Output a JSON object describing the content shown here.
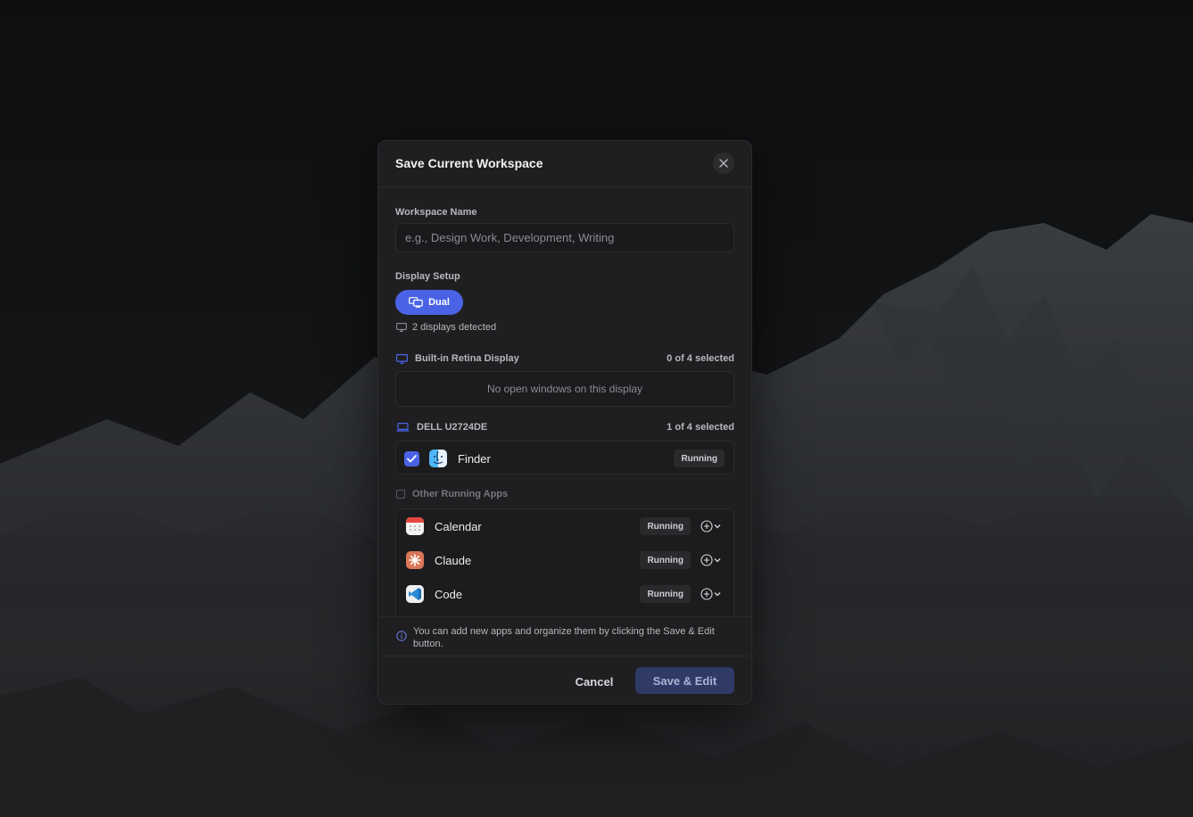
{
  "dialog": {
    "title": "Save Current Workspace",
    "close_icon": "close-icon"
  },
  "workspace_name": {
    "label": "Workspace Name",
    "placeholder": "e.g., Design Work, Development, Writing",
    "value": ""
  },
  "display_setup": {
    "label": "Display Setup",
    "selected_option": "Dual",
    "option_icon": "dual-monitor-icon",
    "detected_text": "2 displays detected",
    "accent_color": "#4a63e6"
  },
  "displays": [
    {
      "name": "Built-in Retina Display",
      "icon": "monitor-icon",
      "selection_count": "0 of 4 selected",
      "empty_text": "No open windows on this display",
      "windows": []
    },
    {
      "name": "DELL U2724DE",
      "icon": "laptop-icon",
      "selection_count": "1 of 4 selected",
      "windows": [
        {
          "app": "Finder",
          "status": "Running",
          "checked": true,
          "icon": "finder-icon"
        }
      ]
    }
  ],
  "other_apps": {
    "label": "Other Running Apps",
    "apps": [
      {
        "name": "Calendar",
        "status": "Running",
        "icon": "calendar-icon"
      },
      {
        "name": "Claude",
        "status": "Running",
        "icon": "claude-icon"
      },
      {
        "name": "Code",
        "status": "Running",
        "icon": "vscode-icon"
      }
    ]
  },
  "info": {
    "text": "You can add new apps and organize them by clicking the Save & Edit button.",
    "icon": "info-icon"
  },
  "footer": {
    "cancel_label": "Cancel",
    "save_label": "Save & Edit"
  }
}
